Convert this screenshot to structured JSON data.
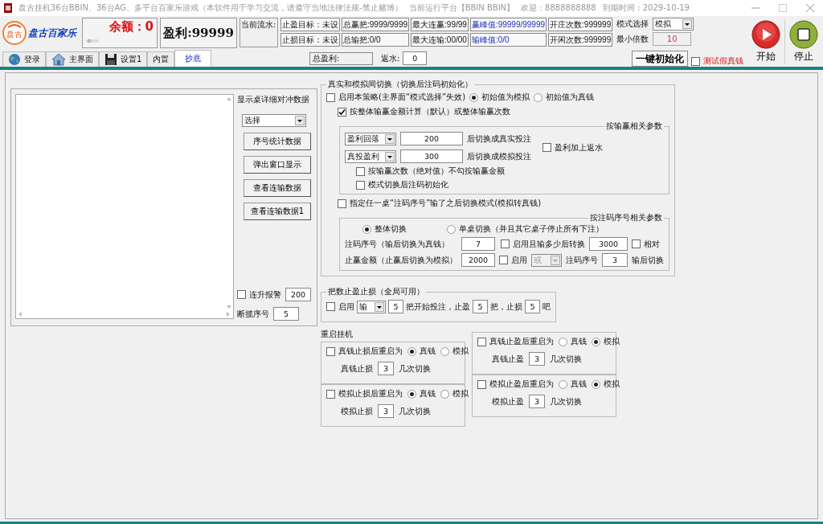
{
  "window": {
    "title": "盘古挂机36台BBIN、36台AG、多平台百家乐游戏（本软件用于学习交流，请遵守当地法律法规-禁止赌博）",
    "platform": "当前运行平台【BBIN BBIN】",
    "welcome": "欢迎：8888888888",
    "expiry": "到期时间：2029-10-19"
  },
  "header": {
    "logo_badge": "盘古",
    "logo_text": "盘古百家乐",
    "balance": "余额：0",
    "profit": "盈利:99999",
    "flow_label": "当前流水:",
    "stats": [
      [
        {
          "text": "止盈目标：未设",
          "kind": "plain"
        },
        {
          "text": "总赢把:9999/9999",
          "kind": "plain"
        },
        {
          "text": "最大连赢:99/99",
          "kind": "plain"
        },
        {
          "text": "赢峰值:99999/99999",
          "kind": "peak"
        },
        {
          "text": "开庄次数:999999",
          "kind": "plain"
        }
      ],
      [
        {
          "text": "止损目标：未设",
          "kind": "plain"
        },
        {
          "text": "总输把:0/0",
          "kind": "plain"
        },
        {
          "text": "最大连输:00/00",
          "kind": "plain"
        },
        {
          "text": "输峰值:0/0",
          "kind": "peak"
        },
        {
          "text": "开闲次数:999999",
          "kind": "plain"
        }
      ]
    ],
    "mode_label": "模式选择",
    "mode_value": "模拟",
    "min_label": "最小倍数",
    "min_value": "10",
    "total_profit": "总盈利:",
    "rebate_label": "返水:",
    "rebate_value": "0",
    "init_button": "一键初始化",
    "test_check": {
      "label": "测试假真钱",
      "checked": false
    },
    "start": "开始",
    "stop": "停止"
  },
  "tabs": [
    {
      "label": "登录",
      "selected": false
    },
    {
      "label": "主界面",
      "selected": false
    },
    {
      "label": "设置1",
      "selected": false
    },
    {
      "label": "内置",
      "selected": false
    },
    {
      "label": "抄底",
      "selected": true
    }
  ],
  "left_panel": {
    "title": "显示桌详细对冲数据",
    "select": "选择",
    "buttons": [
      "序号统计数据",
      "弹出窗口显示",
      "查看连输数据",
      "查看连输数据1"
    ],
    "alarm": {
      "label": "连升报警",
      "checked": false
    },
    "alarm_value": "200",
    "break_label": "断揽序号",
    "break_value": "5"
  },
  "switch_group": {
    "title": "真实和模拟间切换（切换后注码初始化）",
    "enable": {
      "label": "启用本策略(主界面“模式选择”失效)",
      "checked": false
    },
    "initial": [
      {
        "label": "初始值为模拟",
        "selected": true
      },
      {
        "label": "初始值为真钱",
        "selected": false
      }
    ],
    "by_total": {
      "label": "按整体输赢金额计算（默认）或整体输赢次数",
      "checked": true
    },
    "win_loss": {
      "title": "按输赢相关参数",
      "rows": [
        {
          "select": "盈利回落",
          "value": "200",
          "suffix": "后切换成真实投注"
        },
        {
          "select": "真投盈利",
          "value": "300",
          "suffix": "后切换成模拟投注"
        }
      ],
      "add_rebate": {
        "label": "盈利加上返水",
        "checked": false
      },
      "options": [
        {
          "label": "按输赢次数（绝对值）不勾按输赢金额",
          "checked": false
        },
        {
          "label": "模式切换后注码初始化",
          "checked": false
        }
      ]
    },
    "by_index": {
      "label": "指定任一桌“注码序号”输了之后切换模式(模拟转真钱)",
      "checked": false
    },
    "index_params": {
      "title": "按注码序号相关参数",
      "scope": [
        {
          "label": "整体切换",
          "selected": true
        },
        {
          "label": "单桌切换（并且其它桌子停止所有下注）",
          "selected": false
        }
      ],
      "index_label": "注码序号（输后切换为真钱）",
      "index_value": "7",
      "loss_enable": {
        "label": "启用且输多少后转换",
        "checked": false
      },
      "loss_value": "3000",
      "relative": {
        "label": "相对",
        "checked": false
      },
      "stop_label": "止赢金额（止赢后切换为模拟）",
      "stop_value": "2000",
      "or_enable": {
        "label": "启用",
        "checked": false
      },
      "or_select": "或",
      "or_index_label": "注码序号",
      "or_index_value": "3",
      "or_suffix": "输后切换"
    }
  },
  "rounds_group": {
    "title": "把数止盈止损（全局可用）",
    "enable": {
      "label": "启用",
      "checked": false
    },
    "select": "输",
    "start_value": "5",
    "start_text": "把开始投注，止盈",
    "win_value": "5",
    "win_text": "把，止损",
    "loss_value": "5",
    "loss_text": "吧"
  },
  "restart_group": {
    "title": "重启挂机",
    "cells": [
      {
        "label": "真钱止损后重启为",
        "checked": false,
        "options": [
          {
            "label": "真钱",
            "selected": true
          },
          {
            "label": "模拟",
            "selected": false
          }
        ],
        "count_label": "真钱止损",
        "count_value": "3",
        "suffix": "几次切换"
      },
      {
        "label": "模拟止损后重启为",
        "checked": false,
        "options": [
          {
            "label": "真钱",
            "selected": true
          },
          {
            "label": "模拟",
            "selected": false
          }
        ],
        "count_label": "模拟止损",
        "count_value": "3",
        "suffix": "几次切换"
      },
      {
        "label": "真钱止盈后重启为",
        "checked": false,
        "options": [
          {
            "label": "真钱",
            "selected": false
          },
          {
            "label": "模拟",
            "selected": true
          }
        ],
        "count_label": "真钱止盈",
        "count_value": "3",
        "suffix": "几次切换"
      },
      {
        "label": "模拟止盈后重启为",
        "checked": false,
        "options": [
          {
            "label": "真钱",
            "selected": false
          },
          {
            "label": "模拟",
            "selected": true
          }
        ],
        "count_label": "模拟止盈",
        "count_value": "3",
        "suffix": "几次切换"
      }
    ]
  }
}
